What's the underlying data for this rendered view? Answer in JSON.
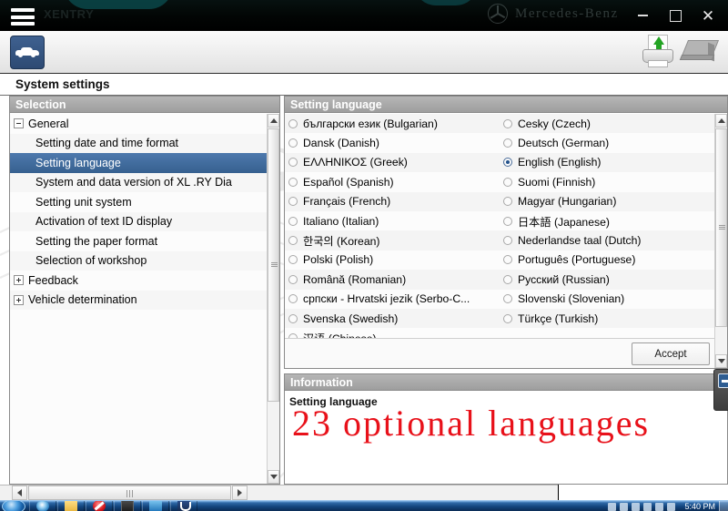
{
  "window": {
    "app_title": "XENTRY",
    "brand": "Mercedes-Benz",
    "minimize_label": "–",
    "maximize_label": "□",
    "close_label": "✕",
    "menu_icon": "hamburger-menu-icon"
  },
  "toolbar": {
    "vehicle_icon": "car-icon",
    "print_icon": "printer-upload-icon",
    "book_icon": "documents-stack-icon"
  },
  "page": {
    "title": "System settings"
  },
  "selection": {
    "header": "Selection",
    "items": [
      {
        "label": "General",
        "level": 0,
        "expander": "minus",
        "selected": false
      },
      {
        "label": "Setting date and time format",
        "level": 1,
        "expander": "none",
        "selected": false
      },
      {
        "label": "Setting language",
        "level": 1,
        "expander": "none",
        "selected": true
      },
      {
        "label": "System and data version of XL    .RY Dia",
        "level": 1,
        "expander": "none",
        "selected": false
      },
      {
        "label": "Setting unit system",
        "level": 1,
        "expander": "none",
        "selected": false
      },
      {
        "label": "Activation of text ID display",
        "level": 1,
        "expander": "none",
        "selected": false
      },
      {
        "label": "Setting the paper format",
        "level": 1,
        "expander": "none",
        "selected": false
      },
      {
        "label": "Selection of workshop",
        "level": 1,
        "expander": "none",
        "selected": false
      },
      {
        "label": "Feedback",
        "level": 0,
        "expander": "plus",
        "selected": false
      },
      {
        "label": "Vehicle determination",
        "level": 0,
        "expander": "plus",
        "selected": false
      }
    ]
  },
  "language_panel": {
    "header": "Setting language",
    "accept_label": "Accept",
    "left_column": [
      {
        "label": "български език (Bulgarian)",
        "selected": false
      },
      {
        "label": "Dansk (Danish)",
        "selected": false
      },
      {
        "label": "ΕΛΛΗΝΙΚΟΣ (Greek)",
        "selected": false
      },
      {
        "label": "Español (Spanish)",
        "selected": false
      },
      {
        "label": "Français (French)",
        "selected": false
      },
      {
        "label": "Italiano (Italian)",
        "selected": false
      },
      {
        "label": "한국의 (Korean)",
        "selected": false
      },
      {
        "label": "Polski (Polish)",
        "selected": false
      },
      {
        "label": "Română (Romanian)",
        "selected": false
      },
      {
        "label": "српски - Hrvatski jezik (Serbo-C...",
        "selected": false
      },
      {
        "label": "Svenska (Swedish)",
        "selected": false
      },
      {
        "label": "汉语 (Chinese)",
        "selected": false
      }
    ],
    "right_column": [
      {
        "label": "Cesky (Czech)",
        "selected": false
      },
      {
        "label": "Deutsch (German)",
        "selected": false
      },
      {
        "label": "English (English)",
        "selected": true
      },
      {
        "label": "Suomi (Finnish)",
        "selected": false
      },
      {
        "label": "Magyar (Hungarian)",
        "selected": false
      },
      {
        "label": "日本語 (Japanese)",
        "selected": false
      },
      {
        "label": "Nederlandse taal (Dutch)",
        "selected": false
      },
      {
        "label": "Português (Portuguese)",
        "selected": false
      },
      {
        "label": "Русский (Russian)",
        "selected": false
      },
      {
        "label": "Slovenski (Slovenian)",
        "selected": false
      },
      {
        "label": "Türkçe (Turkish)",
        "selected": false
      }
    ]
  },
  "information": {
    "header": "Information",
    "text": "Setting language",
    "annotation": "23 optional languages",
    "annotation_color": "#e8111a"
  },
  "taskbar": {
    "start_icon": "windows-start-orb-icon",
    "items": [
      {
        "icon": "internet-explorer-icon"
      },
      {
        "icon": "folder-icon"
      },
      {
        "icon": "blocked-icon"
      },
      {
        "icon": "disk-drive-icon"
      },
      {
        "icon": "blue-app-icon"
      },
      {
        "icon": "horseshoe-app-icon"
      }
    ],
    "clock": "5:40 PM",
    "show_desktop_icon": "show-desktop-icon"
  }
}
